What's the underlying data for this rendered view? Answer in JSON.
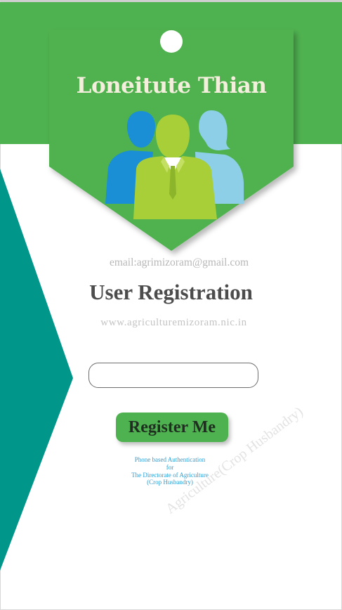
{
  "card": {
    "title": "Loneitute Thian",
    "icon": "user-group-icon"
  },
  "form": {
    "email": "email:agrimizoram@gmail.com",
    "heading": "User Registration",
    "website": "www.agriculturemizoram.nic.in",
    "phone_input": {
      "value": "",
      "placeholder": ""
    },
    "register_label": "Register Me"
  },
  "footnote": {
    "line1": "Phone based Authentication",
    "line2": "for",
    "line3": "The Directorate of Agriculture",
    "line4": "(Crop Husbandry)"
  },
  "watermark": "Agriculture(Crop Husbandry)",
  "colors": {
    "brand_green": "#4fb250",
    "teal": "#00978a",
    "person_blue": "#1a8fd6",
    "person_lightblue": "#8ccfe6",
    "person_lime": "#a8cf38",
    "link_blue": "#2a9fd6"
  }
}
